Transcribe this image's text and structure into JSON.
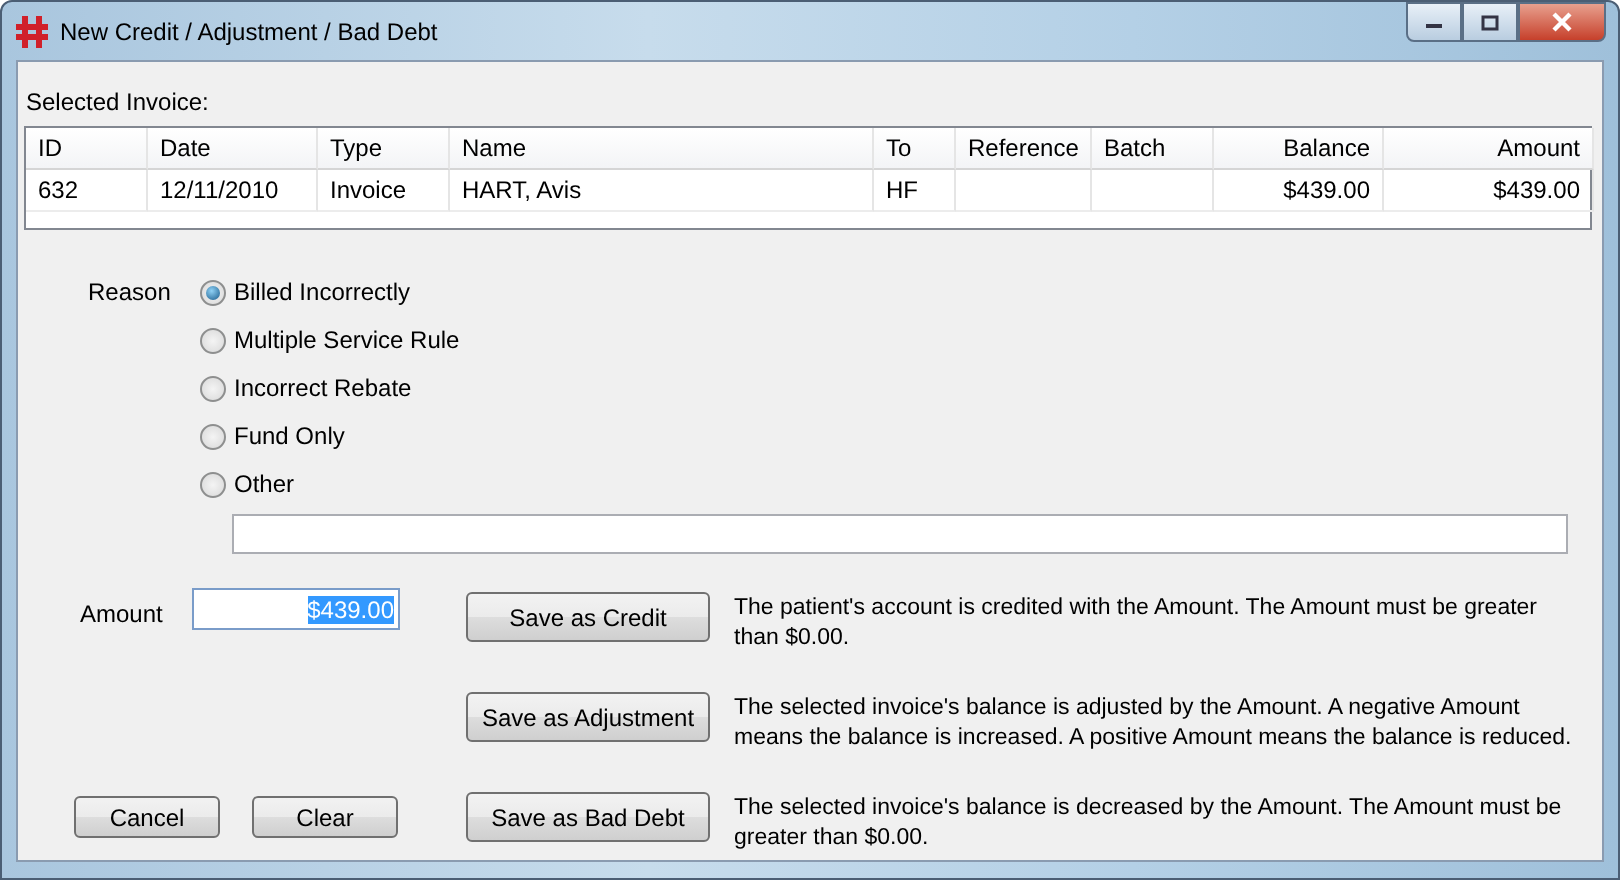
{
  "window": {
    "title": "New Credit / Adjustment / Bad Debt"
  },
  "invoice": {
    "label": "Selected Invoice:",
    "columns": [
      {
        "label": "ID",
        "numeric": false
      },
      {
        "label": "Date",
        "numeric": false
      },
      {
        "label": "Type",
        "numeric": false
      },
      {
        "label": "Name",
        "numeric": false
      },
      {
        "label": "To",
        "numeric": false
      },
      {
        "label": "Reference",
        "numeric": false
      },
      {
        "label": "Batch",
        "numeric": false
      },
      {
        "label": "Balance",
        "numeric": true
      },
      {
        "label": "Amount",
        "numeric": true
      }
    ],
    "rows": [
      {
        "cells": [
          "632",
          "12/11/2010",
          "Invoice",
          "HART, Avis",
          "HF",
          null,
          null,
          "$439.00",
          "$439.00"
        ]
      }
    ]
  },
  "reason": {
    "label": "Reason",
    "options": [
      {
        "label": "Billed Incorrectly",
        "selected": true
      },
      {
        "label": "Multiple Service Rule",
        "selected": false
      },
      {
        "label": "Incorrect Rebate",
        "selected": false
      },
      {
        "label": "Fund Only",
        "selected": false
      },
      {
        "label": "Other",
        "selected": false
      }
    ]
  },
  "amount": {
    "label": "Amount",
    "value": "$439.00",
    "highlighted": true
  },
  "actions": [
    {
      "button": "Save as Credit",
      "description": "The patient's account is credited with the Amount. The Amount must be greater than $0.00."
    },
    {
      "button": "Save as Adjustment",
      "description": "The selected invoice's balance is adjusted by the Amount. A negative Amount means the balance is increased. A positive Amount means the balance is reduced."
    },
    {
      "button": "Save as Bad Debt",
      "description": "The selected invoice's balance is decreased by the Amount. The Amount must be greater than $0.00."
    }
  ],
  "buttons": [
    {
      "label": "Cancel"
    },
    {
      "label": "Clear"
    }
  ]
}
